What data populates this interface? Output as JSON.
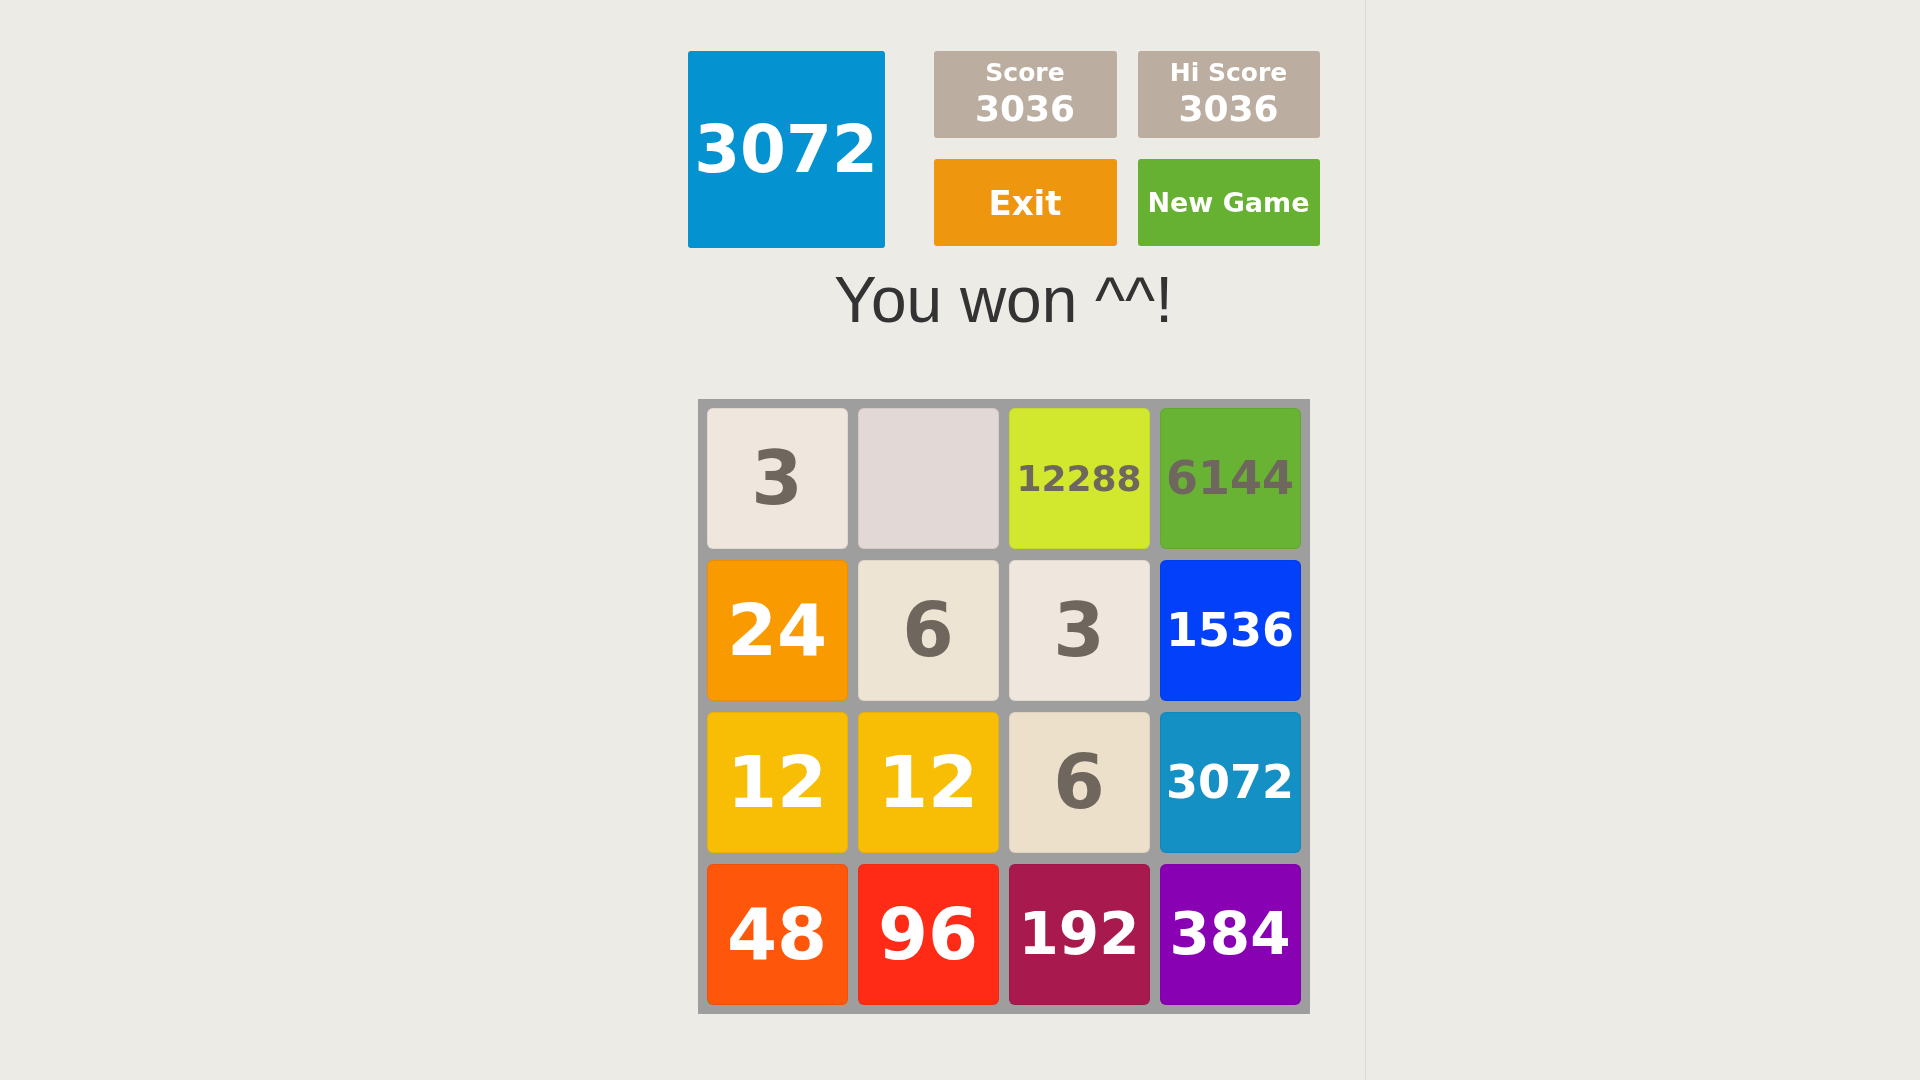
{
  "best_tile": {
    "value": "3072",
    "color": "#0592d0"
  },
  "score": {
    "label": "Score",
    "value": "3036"
  },
  "hi_score": {
    "label": "Hi Score",
    "value": "3036"
  },
  "buttons": [
    {
      "label": "Exit",
      "color": "#ef960f"
    },
    {
      "label": "New Game",
      "color": "#66b132"
    }
  ],
  "message": "You won ^^!",
  "board": [
    [
      {
        "value": "3",
        "color": "#efe7dd",
        "kind": "dark"
      },
      {
        "color": "#e2d8d6",
        "kind": "empty"
      },
      {
        "value": "12288",
        "color": "#d2e82e",
        "kind": "dark"
      },
      {
        "value": "6144",
        "color": "#68b234",
        "kind": "dark"
      }
    ],
    [
      {
        "value": "24",
        "color": "#f99a00",
        "kind": "light"
      },
      {
        "value": "6",
        "color": "#ede4d4",
        "kind": "dark"
      },
      {
        "value": "3",
        "color": "#efe7dd",
        "kind": "dark"
      },
      {
        "value": "1536",
        "color": "#0240fa",
        "kind": "light"
      }
    ],
    [
      {
        "value": "12",
        "color": "#f8be06",
        "kind": "light"
      },
      {
        "value": "12",
        "color": "#f8be06",
        "kind": "light"
      },
      {
        "value": "6",
        "color": "#ede0ca",
        "kind": "dark"
      },
      {
        "value": "3072",
        "color": "#1490c5",
        "kind": "light"
      }
    ],
    [
      {
        "value": "48",
        "color": "#fe560b",
        "kind": "light"
      },
      {
        "value": "96",
        "color": "#ff2b16",
        "kind": "light"
      },
      {
        "value": "192",
        "color": "#a8194d",
        "kind": "light"
      },
      {
        "value": "384",
        "color": "#8802b3",
        "kind": "light"
      }
    ]
  ]
}
